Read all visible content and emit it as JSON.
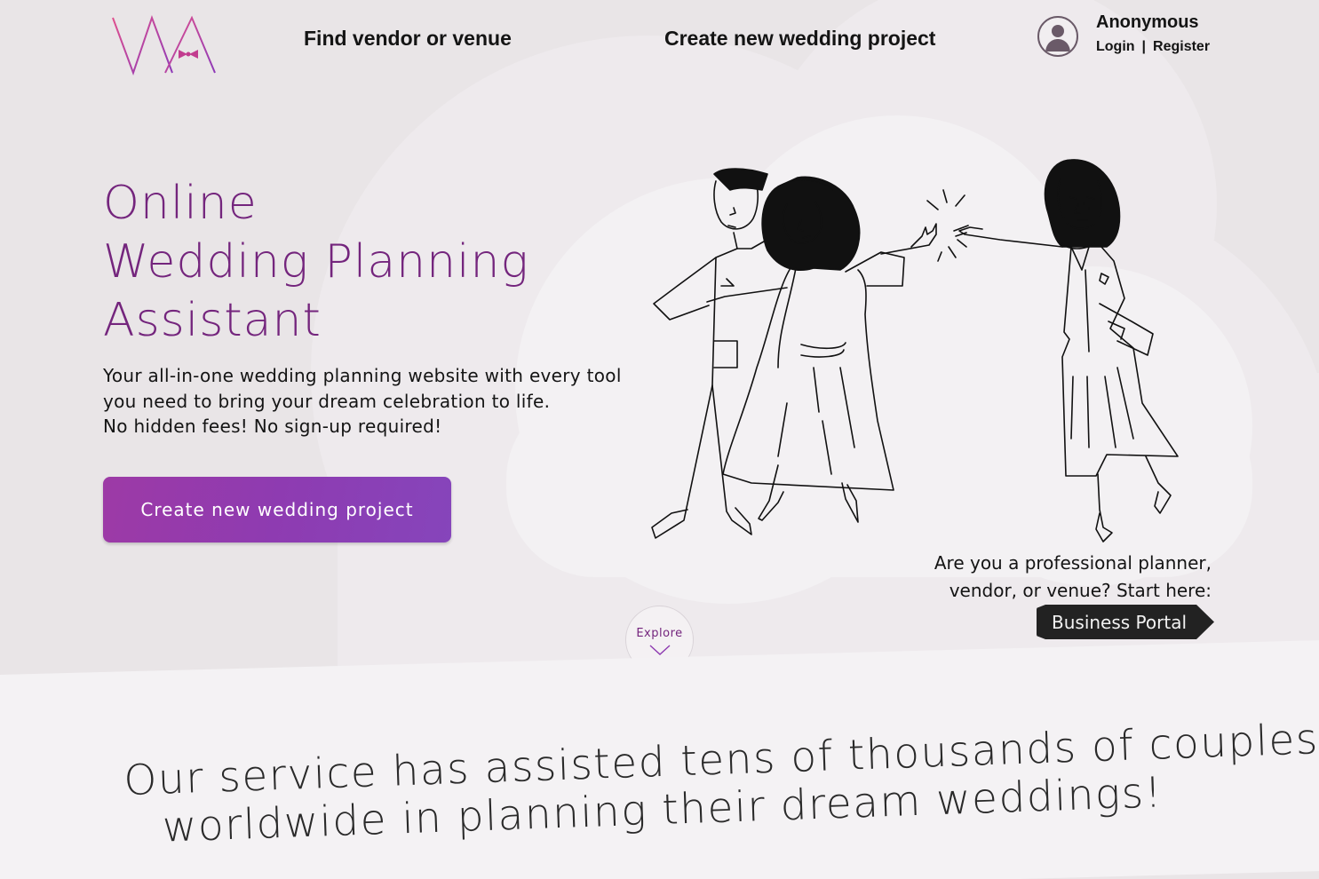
{
  "header": {
    "nav_find": "Find vendor or venue",
    "nav_create": "Create new wedding project",
    "user": {
      "name": "Anonymous",
      "login": "Login",
      "separator": "|",
      "register": "Register"
    }
  },
  "hero": {
    "title_lines": [
      "Online",
      "Wedding Planning",
      "Assistant"
    ],
    "description_lines": [
      "Your all-in-one wedding planning website with every tool",
      "you need to bring your dream celebration to life.",
      "No hidden fees! No sign-up required!"
    ],
    "cta_label": "Create new wedding project"
  },
  "business": {
    "question_lines": [
      "Are you a professional planner,",
      "vendor, or venue? Start here:"
    ],
    "portal_label": "Business Portal"
  },
  "explore": {
    "label": "Explore"
  },
  "stats": {
    "lines": [
      "Our service has assisted tens of thousands of couples",
      "worldwide in planning their dream weddings!"
    ]
  },
  "colors": {
    "brand_purple": "#74257d",
    "cta_gradient_start": "#9d3aa6",
    "cta_gradient_end": "#8645bb",
    "portal_dark": "#222222",
    "background": "#e9e5e7"
  },
  "icons": {
    "logo": "wa-bowtie-logo",
    "avatar": "user-avatar-icon",
    "explore": "chevron-down-icon"
  }
}
